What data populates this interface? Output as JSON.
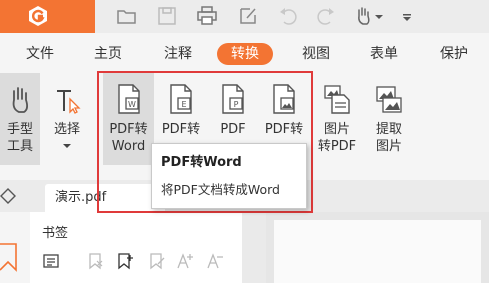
{
  "colors": {
    "accent": "#f37433",
    "highlight": "#e03a3a"
  },
  "menu": {
    "items": [
      "文件",
      "主页",
      "注释",
      "转换",
      "视图",
      "表单",
      "保护"
    ],
    "active": "转换"
  },
  "ribbon": {
    "hand_tool": [
      "手型",
      "工具"
    ],
    "select_tool": "选择",
    "pdf_to_word": [
      "PDF转",
      "Word"
    ],
    "pdf_to_excel": "PDF转",
    "pdf_to_ppt": "PDF",
    "pdf_to_image": "PDF转",
    "image_to_pdf": [
      "图片",
      "转PDF"
    ],
    "extract_image": [
      "提取",
      "图片"
    ]
  },
  "tooltip": {
    "title": "PDF转Word",
    "description": "将PDF文档转成Word"
  },
  "tab": {
    "filename": "演示.pdf"
  },
  "panel": {
    "title": "书签"
  }
}
